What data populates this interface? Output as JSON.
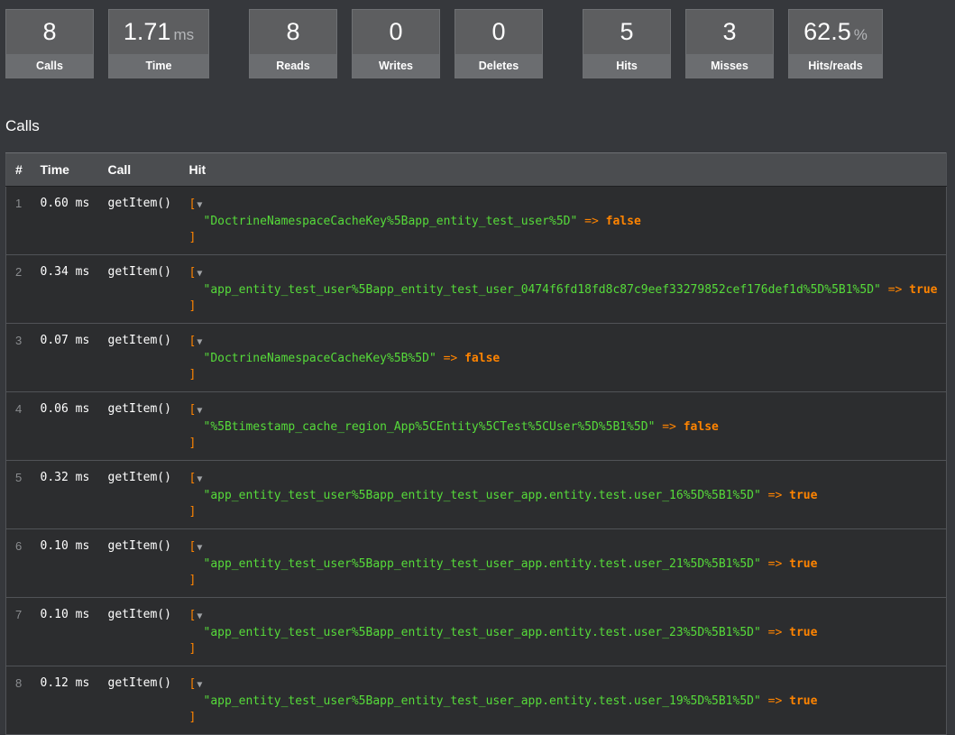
{
  "metrics": [
    {
      "value": "8",
      "unit": "",
      "label": "Calls"
    },
    {
      "value": "1.71",
      "unit": "ms",
      "label": "Time"
    },
    {
      "value": "8",
      "unit": "",
      "label": "Reads"
    },
    {
      "value": "0",
      "unit": "",
      "label": "Writes"
    },
    {
      "value": "0",
      "unit": "",
      "label": "Deletes"
    },
    {
      "value": "5",
      "unit": "",
      "label": "Hits"
    },
    {
      "value": "3",
      "unit": "",
      "label": "Misses"
    },
    {
      "value": "62.5",
      "unit": "%",
      "label": "Hits/reads"
    }
  ],
  "section_title": "Calls",
  "table": {
    "headers": {
      "num": "#",
      "time": "Time",
      "call": "Call",
      "hit": "Hit"
    },
    "dump": {
      "open": "[",
      "close": "]",
      "toggle": "▼",
      "arrow": "=>"
    },
    "rows": [
      {
        "num": "1",
        "time": "0.60 ms",
        "call": "getItem()",
        "key": "\"DoctrineNamespaceCacheKey%5Bapp_entity_test_user%5D\"",
        "hit": "false"
      },
      {
        "num": "2",
        "time": "0.34 ms",
        "call": "getItem()",
        "key": "\"app_entity_test_user%5Bapp_entity_test_user_0474f6fd18fd8c87c9eef33279852cef176def1d%5D%5B1%5D\"",
        "hit": "true"
      },
      {
        "num": "3",
        "time": "0.07 ms",
        "call": "getItem()",
        "key": "\"DoctrineNamespaceCacheKey%5B%5D\"",
        "hit": "false"
      },
      {
        "num": "4",
        "time": "0.06 ms",
        "call": "getItem()",
        "key": "\"%5Btimestamp_cache_region_App%5CEntity%5CTest%5CUser%5D%5B1%5D\"",
        "hit": "false"
      },
      {
        "num": "5",
        "time": "0.32 ms",
        "call": "getItem()",
        "key": "\"app_entity_test_user%5Bapp_entity_test_user_app.entity.test.user_16%5D%5B1%5D\"",
        "hit": "true"
      },
      {
        "num": "6",
        "time": "0.10 ms",
        "call": "getItem()",
        "key": "\"app_entity_test_user%5Bapp_entity_test_user_app.entity.test.user_21%5D%5B1%5D\"",
        "hit": "true"
      },
      {
        "num": "7",
        "time": "0.10 ms",
        "call": "getItem()",
        "key": "\"app_entity_test_user%5Bapp_entity_test_user_app.entity.test.user_23%5D%5B1%5D\"",
        "hit": "true"
      },
      {
        "num": "8",
        "time": "0.12 ms",
        "call": "getItem()",
        "key": "\"app_entity_test_user%5Bapp_entity_test_user_app.entity.test.user_19%5D%5B1%5D\"",
        "hit": "true"
      }
    ]
  }
}
